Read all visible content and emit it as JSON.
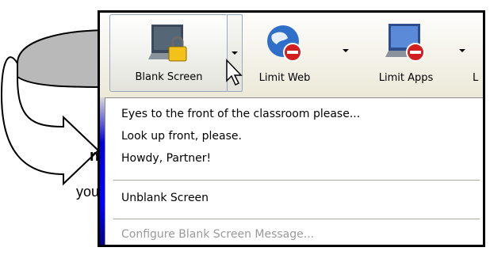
{
  "fragments": {
    "bold": "n",
    "plain": "you"
  },
  "toolbar": {
    "buttons": [
      {
        "label": "Blank Screen",
        "icon": "monitor-lock-icon"
      },
      {
        "label": "Limit Web",
        "icon": "globe-blocked-icon"
      },
      {
        "label": "Limit Apps",
        "icon": "monitor-blocked-icon"
      },
      {
        "label": "L",
        "icon": ""
      }
    ]
  },
  "menu": {
    "items": [
      {
        "label": "Eyes to the front of the classroom please...",
        "enabled": true
      },
      {
        "label": "Look up front, please.",
        "enabled": true
      },
      {
        "label": "Howdy, Partner!",
        "enabled": true
      },
      {
        "label": "Unblank Screen",
        "enabled": true
      },
      {
        "label": "Configure Blank Screen Message...",
        "enabled": false
      }
    ]
  },
  "colors": {
    "toolbar_bg": "#ece9d8",
    "menu_separator": "#aca899",
    "disabled_text": "#9a9a9a",
    "desktop_blue": "#0000ff"
  }
}
